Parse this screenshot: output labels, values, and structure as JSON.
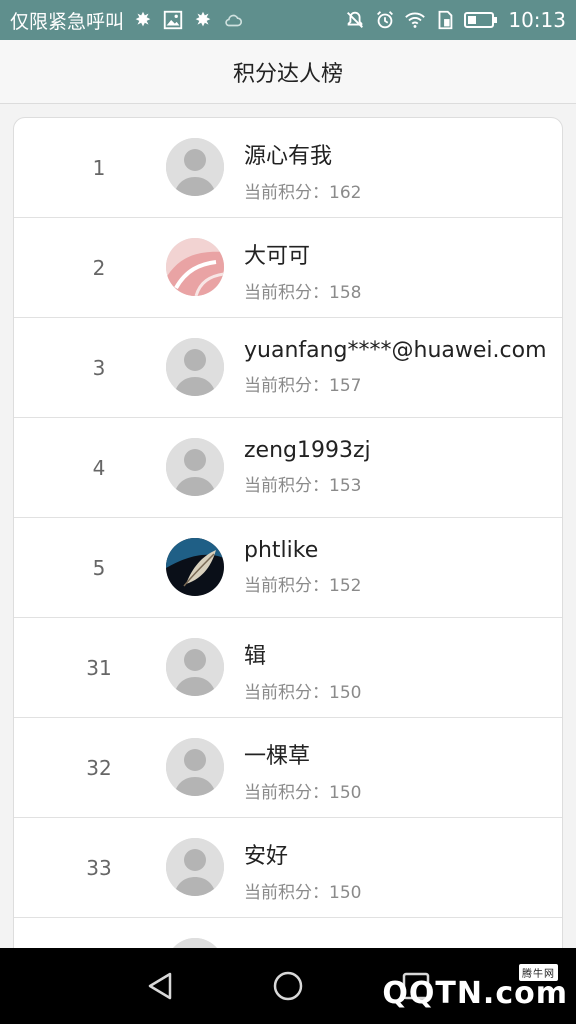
{
  "status_bar": {
    "carrier_text": "仅限紧急呼叫",
    "time": "10:13",
    "icons": [
      "snow-flake-icon",
      "image-icon",
      "snow-flake-icon",
      "cloud-icon",
      "mute-icon",
      "alarm-icon",
      "wifi-icon",
      "sim-icon",
      "battery-icon"
    ]
  },
  "header": {
    "title": "积分达人榜"
  },
  "leaderboard": {
    "score_prefix": "当前积分：",
    "rows": [
      {
        "rank": "1",
        "name": "源心有我",
        "score": "当前积分：162",
        "avatar": "default"
      },
      {
        "rank": "2",
        "name": "大可可",
        "score": "当前积分：158",
        "avatar": "photo-pink"
      },
      {
        "rank": "3",
        "name": "yuanfang****@huawei.com",
        "score": "当前积分：157",
        "avatar": "default"
      },
      {
        "rank": "4",
        "name": "zeng1993zj",
        "score": "当前积分：153",
        "avatar": "default"
      },
      {
        "rank": "5",
        "name": "phtlike",
        "score": "当前积分：152",
        "avatar": "photo-feather"
      },
      {
        "rank": "31",
        "name": "辑",
        "score": "当前积分：150",
        "avatar": "default"
      },
      {
        "rank": "32",
        "name": "一棵草",
        "score": "当前积分：150",
        "avatar": "default"
      },
      {
        "rank": "33",
        "name": "安好",
        "score": "当前积分：150",
        "avatar": "default"
      },
      {
        "rank": "",
        "name": "",
        "score": "",
        "avatar": "default"
      }
    ]
  },
  "nav_bar": {
    "buttons": [
      "back-icon",
      "home-icon",
      "recents-icon"
    ],
    "watermark": "QQTN.com",
    "watermark_badge": "腾牛网"
  }
}
